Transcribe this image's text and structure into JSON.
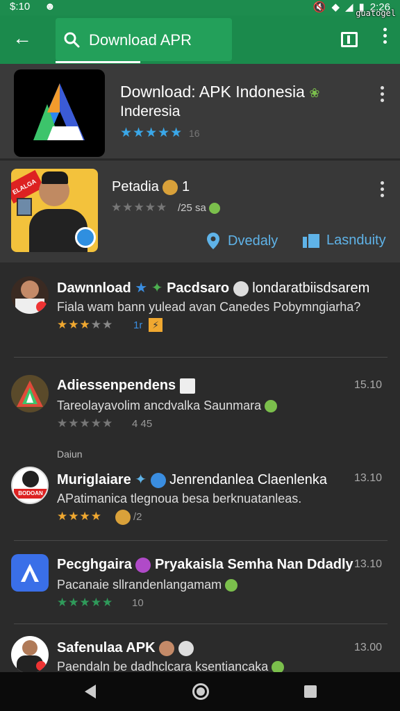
{
  "status_bar": {
    "time": "$:10",
    "right_time": "2:26"
  },
  "watermark": "guatogel",
  "toolbar": {
    "search_text": "Download APR"
  },
  "featured_app": {
    "title": "Download: APK Indonesia",
    "subtitle": "Inderesia",
    "rating_count": "16"
  },
  "second_app": {
    "title": "Petadia",
    "title_suffix": "1",
    "rating_text": "/25 sa",
    "action_1": "Dvedaly",
    "action_2": "Lasnduity",
    "badge_text": "ELALGA"
  },
  "section_label": "Daiun",
  "list_items": [
    {
      "title": "Dawnnload",
      "title_mid": "Pacdsaro",
      "title_end": "londaratbiisdsarem",
      "desc": "Fiala wam bann yulead avan Canedes Pobymngiarha?",
      "meta": "1r",
      "date": ""
    },
    {
      "title": "Adiessenpendens",
      "title_mid": "",
      "title_end": "",
      "desc": "Tareolayavolim ancdvalka Saunmara",
      "meta": "4 45",
      "date": "15.10"
    },
    {
      "title": "Muriglaiare",
      "title_mid": "",
      "title_end": "Jenrendanlea Claenlenka",
      "desc": "APatimanica tlegnoua besa berknuatanleas.",
      "meta": "/2",
      "date": "13.10",
      "avatar_text": "BODOAN"
    },
    {
      "title": "Pecghgaira",
      "title_mid": "Pryakaisla Semha Nan Ddadly",
      "title_end": "",
      "desc": "Pacanaie sllrandenlangamam",
      "meta": "10",
      "date": "13.10"
    },
    {
      "title": "Safenulaa APK",
      "title_mid": "",
      "title_end": "",
      "desc": "Paendaln be dadhclcara ksentiancaka",
      "meta": "",
      "date": "13.00"
    }
  ]
}
